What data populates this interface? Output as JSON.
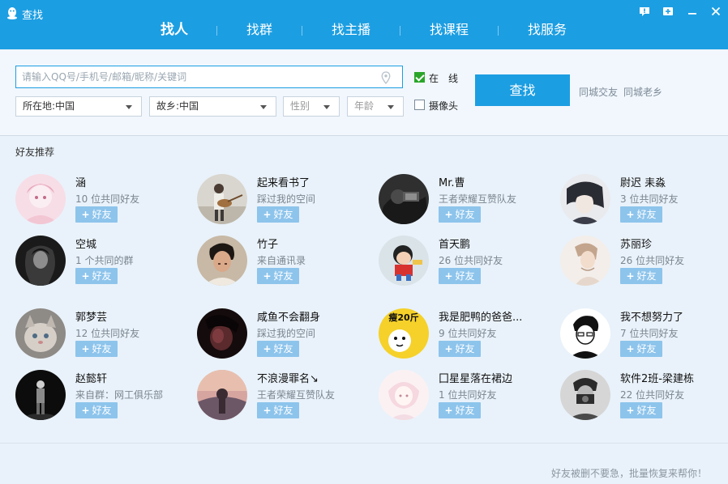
{
  "window": {
    "title": "查找",
    "controls": [
      "feedback-icon",
      "add-icon",
      "minimize-icon",
      "close-icon"
    ]
  },
  "tabs": [
    {
      "label": "找人",
      "active": true
    },
    {
      "label": "找群",
      "active": false
    },
    {
      "label": "找主播",
      "active": false
    },
    {
      "label": "找课程",
      "active": false
    },
    {
      "label": "找服务",
      "active": false
    }
  ],
  "search": {
    "placeholder": "请输入QQ号/手机号/邮箱/昵称/关键词",
    "value": "",
    "location_select": "所在地:中国",
    "hometown_select": "故乡:中国",
    "gender_select": "性别",
    "age_select": "年龄",
    "online_label": "在　线",
    "online_checked": true,
    "camera_label": "摄像头",
    "camera_checked": false,
    "button_label": "查找",
    "link_local": "同城交友",
    "link_hometown": "同城老乡"
  },
  "recommend": {
    "title": "好友推荐",
    "add_label": "好友",
    "users": [
      {
        "name": "涵",
        "sub": "10 位共同好友"
      },
      {
        "name": "起来看书了",
        "sub": "踩过我的空间"
      },
      {
        "name": "Mr.曹",
        "sub": "王者荣耀互赞队友"
      },
      {
        "name": "尉迟 耒淼",
        "sub": "3 位共同好友"
      },
      {
        "name": "空城",
        "sub": "1 个共同的群"
      },
      {
        "name": "竹子",
        "sub": "来自通讯录"
      },
      {
        "name": "首天鹏",
        "sub": "26 位共同好友"
      },
      {
        "name": "苏丽珍",
        "sub": "26 位共同好友"
      },
      {
        "name": "郭梦芸",
        "sub": "12 位共同好友"
      },
      {
        "name": "咸鱼不会翻身",
        "sub": "踩过我的空间"
      },
      {
        "name": "我是肥鸭的爸爸...",
        "sub": "9 位共同好友"
      },
      {
        "name": "我不想努力了",
        "sub": "7 位共同好友"
      },
      {
        "name": "赵懿轩",
        "sub": "来自群：网工俱乐部"
      },
      {
        "name": "不浪漫罪名↘",
        "sub": "王者荣耀互赞队友"
      },
      {
        "name": "囗星星落在裙边",
        "sub": "1 位共同好友"
      },
      {
        "name": "软件2班-梁建栋",
        "sub": "22 位共同好友"
      }
    ]
  },
  "footer": {
    "text": "好友被删不要急，批量恢复来帮你！"
  },
  "colors": {
    "accent": "#1c9ee2",
    "add_button": "#8dc4ec",
    "background": "#e9f2fa",
    "online_check": "#2aa52a"
  }
}
